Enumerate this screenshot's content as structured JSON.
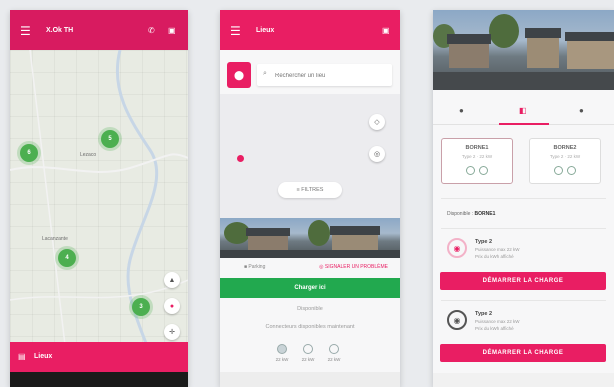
{
  "colors": {
    "magenta": "#e91e63",
    "green": "#22a94f",
    "map_cluster": "#4caf50"
  },
  "screen1": {
    "header_title": "X.Ok TH",
    "menu_icon": "hamburger-icon",
    "header_icons": [
      "phone-icon",
      "cart-icon"
    ],
    "clusters": [
      "6",
      "5",
      "4",
      "3"
    ],
    "map_labels": [
      "Lezaco",
      "Lacanzante"
    ],
    "map_controls": [
      "locate-icon",
      "pink-pin-icon",
      "compass-icon"
    ],
    "bottom_tab_label": "Lieux"
  },
  "screen2": {
    "header_title": "Lieux",
    "search_placeholder": "Rechercher un lieu",
    "filter_label": "≡ FILTRES",
    "info_left": "■ Parking",
    "info_right": "◎ SIGNALER UN PROBLÈME",
    "green_button": "Charger ici",
    "subtext_1": "Disponible",
    "subtext_2": "Connecteurs disponibles maintenant",
    "connectors": [
      {
        "label": "22 kW"
      },
      {
        "label": "22 kW"
      },
      {
        "label": "22 kW"
      }
    ]
  },
  "screen3": {
    "tabs": [
      "●",
      "◧",
      "●"
    ],
    "cards": [
      {
        "name": "BORNE1",
        "sub": "Type 2 · 22 kW"
      },
      {
        "name": "BORNE2",
        "sub": "Type 2 · 22 kW"
      }
    ],
    "availability_label": "Disponible :",
    "availability_value": "BORNE1",
    "plugs": [
      {
        "title": "Type 2",
        "line1": "Puissance max 22 kW",
        "line2": "Prix du kWh affiché"
      },
      {
        "title": "Type 2",
        "line1": "Puissance max 22 kW",
        "line2": "Prix du kWh affiché"
      }
    ],
    "start_button": "DÉMARRER LA CHARGE"
  }
}
